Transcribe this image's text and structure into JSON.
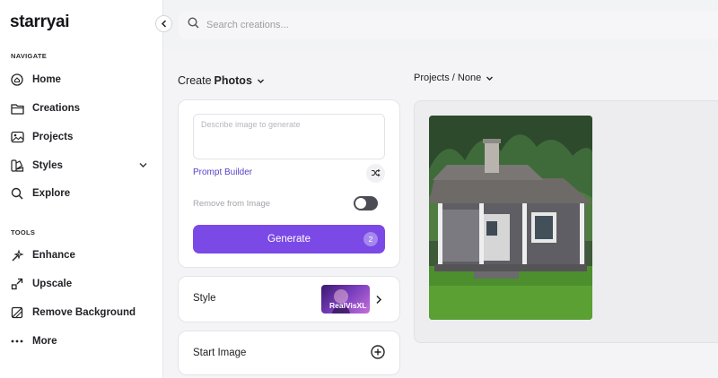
{
  "app": {
    "logo": "starryai"
  },
  "sidebar": {
    "navigate_label": "NAVIGATE",
    "tools_label": "TOOLS",
    "nav": [
      {
        "label": "Home",
        "icon": "home-icon"
      },
      {
        "label": "Creations",
        "icon": "folder-icon"
      },
      {
        "label": "Projects",
        "icon": "image-icon"
      },
      {
        "label": "Styles",
        "icon": "styles-icon"
      },
      {
        "label": "Explore",
        "icon": "search-icon"
      }
    ],
    "tools": [
      {
        "label": "Enhance",
        "icon": "wand-icon"
      },
      {
        "label": "Upscale",
        "icon": "upscale-icon"
      },
      {
        "label": "Remove Background",
        "icon": "remove-bg-icon"
      },
      {
        "label": "More",
        "icon": "more-icon"
      }
    ]
  },
  "search": {
    "placeholder": "Search creations..."
  },
  "create": {
    "prefix": "Create",
    "mode": "Photos",
    "prompt_placeholder": "Describe image to generate",
    "prompt_value": "",
    "prompt_builder": "Prompt Builder",
    "remove_from_image": "Remove from Image",
    "remove_toggle_on": false,
    "generate_label": "Generate",
    "generate_count": "2",
    "style_label": "Style",
    "style_name": "RealVisXL",
    "start_image_label": "Start Image"
  },
  "projects": {
    "label": "Projects / None"
  },
  "colors": {
    "accent": "#7b49e6",
    "link": "#5a3fc9"
  }
}
